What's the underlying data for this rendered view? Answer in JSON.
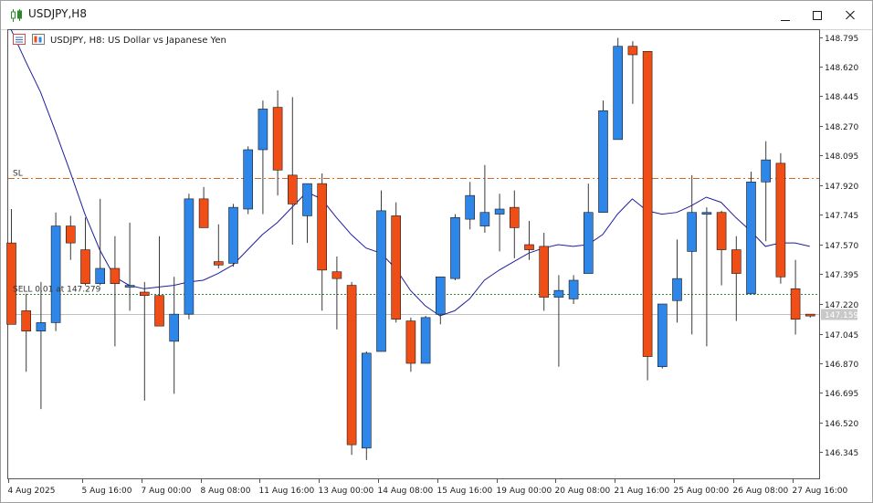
{
  "window": {
    "title": "USDJPY,H8",
    "minimize_icon": "minimize-icon",
    "maximize_icon": "maximize-icon",
    "close_icon": "close-icon"
  },
  "chart_header": {
    "text": "USDJPY, H8:  US Dollar vs Japanese Yen",
    "icons": [
      "one-click-trading-icon",
      "chart-properties-icon"
    ]
  },
  "colors": {
    "bull": "#2e86e8",
    "bear": "#f04e17",
    "wick": "#3a3a3a",
    "ma": "#1e1e9c",
    "sl_line": "#d2691e",
    "trade_line": "#2e8b2e",
    "bid_line": "#c0c0c0",
    "bid_label_bg": "#c8c8c8"
  },
  "chart_data": {
    "type": "candlestick",
    "symbol": "USDJPY",
    "timeframe": "H8",
    "title": "USDJPY, H8:  US Dollar vs Japanese Yen",
    "ylim": [
      146.2,
      148.9
    ],
    "y_ticks": [
      "148.795",
      "148.620",
      "148.445",
      "148.270",
      "148.095",
      "147.920",
      "147.745",
      "147.570",
      "147.395",
      "147.220",
      "147.045",
      "146.870",
      "146.695",
      "146.520",
      "146.345"
    ],
    "x_ticks": [
      {
        "label": "4 Aug 2025",
        "bar": 0
      },
      {
        "label": "5 Aug 16:00",
        "bar": 5
      },
      {
        "label": "7 Aug 00:00",
        "bar": 9
      },
      {
        "label": "8 Aug 08:00",
        "bar": 13
      },
      {
        "label": "11 Aug 16:00",
        "bar": 17
      },
      {
        "label": "13 Aug 00:00",
        "bar": 21
      },
      {
        "label": "14 Aug 08:00",
        "bar": 25
      },
      {
        "label": "15 Aug 16:00",
        "bar": 29
      },
      {
        "label": "19 Aug 00:00",
        "bar": 33
      },
      {
        "label": "20 Aug 08:00",
        "bar": 37
      },
      {
        "label": "21 Aug 16:00",
        "bar": 41
      },
      {
        "label": "25 Aug 00:00",
        "bar": 45
      },
      {
        "label": "26 Aug 08:00",
        "bar": 49
      },
      {
        "label": "27 Aug 16:00",
        "bar": 53
      }
    ],
    "candles": [
      {
        "o": 147.58,
        "h": 147.78,
        "l": 147.1,
        "c": 147.1
      },
      {
        "o": 147.18,
        "h": 147.28,
        "l": 146.82,
        "c": 147.06
      },
      {
        "o": 147.06,
        "h": 147.35,
        "l": 146.6,
        "c": 147.11
      },
      {
        "o": 147.11,
        "h": 147.76,
        "l": 147.06,
        "c": 147.68
      },
      {
        "o": 147.68,
        "h": 147.74,
        "l": 147.48,
        "c": 147.58
      },
      {
        "o": 147.54,
        "h": 147.73,
        "l": 147.33,
        "c": 147.34
      },
      {
        "o": 147.34,
        "h": 147.84,
        "l": 147.33,
        "c": 147.43
      },
      {
        "o": 147.43,
        "h": 147.62,
        "l": 146.97,
        "c": 147.34
      },
      {
        "o": 147.33,
        "h": 147.7,
        "l": 147.18,
        "c": 147.33
      },
      {
        "o": 147.29,
        "h": 147.35,
        "l": 146.65,
        "c": 147.27
      },
      {
        "o": 147.27,
        "h": 147.62,
        "l": 147.1,
        "c": 147.09
      },
      {
        "o": 147.0,
        "h": 147.38,
        "l": 146.69,
        "c": 147.16
      },
      {
        "o": 147.16,
        "h": 147.87,
        "l": 147.13,
        "c": 147.84
      },
      {
        "o": 147.84,
        "h": 147.91,
        "l": 147.67,
        "c": 147.67
      },
      {
        "o": 147.47,
        "h": 147.69,
        "l": 147.43,
        "c": 147.45
      },
      {
        "o": 147.46,
        "h": 147.81,
        "l": 147.44,
        "c": 147.79
      },
      {
        "o": 147.78,
        "h": 148.15,
        "l": 147.75,
        "c": 148.13
      },
      {
        "o": 148.13,
        "h": 148.42,
        "l": 147.75,
        "c": 148.37
      },
      {
        "o": 148.38,
        "h": 148.48,
        "l": 147.86,
        "c": 148.01
      },
      {
        "o": 147.98,
        "h": 148.44,
        "l": 147.57,
        "c": 147.81
      },
      {
        "o": 147.74,
        "h": 147.9,
        "l": 147.58,
        "c": 147.93
      },
      {
        "o": 147.93,
        "h": 147.99,
        "l": 147.18,
        "c": 147.42
      },
      {
        "o": 147.41,
        "h": 147.5,
        "l": 147.07,
        "c": 147.37
      },
      {
        "o": 147.33,
        "h": 147.35,
        "l": 146.33,
        "c": 146.39
      },
      {
        "o": 146.37,
        "h": 146.94,
        "l": 146.3,
        "c": 146.93
      },
      {
        "o": 146.94,
        "h": 147.89,
        "l": 146.94,
        "c": 147.77
      },
      {
        "o": 147.74,
        "h": 147.82,
        "l": 147.11,
        "c": 147.13
      },
      {
        "o": 147.12,
        "h": 147.14,
        "l": 146.82,
        "c": 146.87
      },
      {
        "o": 146.87,
        "h": 147.15,
        "l": 146.87,
        "c": 147.14
      },
      {
        "o": 147.16,
        "h": 147.35,
        "l": 147.1,
        "c": 147.38
      },
      {
        "o": 147.37,
        "h": 147.75,
        "l": 147.36,
        "c": 147.73
      },
      {
        "o": 147.72,
        "h": 147.94,
        "l": 147.66,
        "c": 147.86
      },
      {
        "o": 147.68,
        "h": 148.04,
        "l": 147.64,
        "c": 147.76
      },
      {
        "o": 147.75,
        "h": 147.87,
        "l": 147.53,
        "c": 147.78
      },
      {
        "o": 147.79,
        "h": 147.89,
        "l": 147.49,
        "c": 147.67
      },
      {
        "o": 147.57,
        "h": 147.71,
        "l": 147.48,
        "c": 147.54
      },
      {
        "o": 147.56,
        "h": 147.64,
        "l": 147.18,
        "c": 147.26
      },
      {
        "o": 147.26,
        "h": 147.39,
        "l": 146.85,
        "c": 147.3
      },
      {
        "o": 147.25,
        "h": 147.39,
        "l": 147.22,
        "c": 147.36
      },
      {
        "o": 147.4,
        "h": 147.93,
        "l": 147.4,
        "c": 147.76
      },
      {
        "o": 147.76,
        "h": 148.42,
        "l": 147.76,
        "c": 148.36
      },
      {
        "o": 148.19,
        "h": 148.79,
        "l": 148.19,
        "c": 148.74
      },
      {
        "o": 148.74,
        "h": 148.77,
        "l": 148.4,
        "c": 148.69
      },
      {
        "o": 148.71,
        "h": 148.71,
        "l": 146.77,
        "c": 146.91
      },
      {
        "o": 146.85,
        "h": 147.21,
        "l": 146.84,
        "c": 147.22
      },
      {
        "o": 147.24,
        "h": 147.6,
        "l": 147.11,
        "c": 147.37
      },
      {
        "o": 147.53,
        "h": 147.98,
        "l": 147.04,
        "c": 147.76
      },
      {
        "o": 147.76,
        "h": 147.79,
        "l": 146.97,
        "c": 147.76
      },
      {
        "o": 147.76,
        "h": 147.77,
        "l": 147.33,
        "c": 147.54
      },
      {
        "o": 147.54,
        "h": 147.62,
        "l": 147.12,
        "c": 147.4
      },
      {
        "o": 147.28,
        "h": 148.0,
        "l": 147.28,
        "c": 147.94
      },
      {
        "o": 147.94,
        "h": 148.18,
        "l": 147.59,
        "c": 148.07
      },
      {
        "o": 148.05,
        "h": 148.11,
        "l": 147.34,
        "c": 147.38
      },
      {
        "o": 147.31,
        "h": 147.48,
        "l": 147.04,
        "c": 147.13
      },
      {
        "o": 147.16,
        "h": 147.16,
        "l": 147.14,
        "c": 147.159
      }
    ],
    "moving_average": [
      148.84,
      148.65,
      148.47,
      148.24,
      148.0,
      147.75,
      147.54,
      147.38,
      147.33,
      147.31,
      147.32,
      147.33,
      147.35,
      147.36,
      147.4,
      147.45,
      147.54,
      147.63,
      147.7,
      147.79,
      147.88,
      147.84,
      147.73,
      147.63,
      147.55,
      147.52,
      147.43,
      147.3,
      147.21,
      147.15,
      147.18,
      147.25,
      147.36,
      147.42,
      147.47,
      147.52,
      147.55,
      147.57,
      147.56,
      147.57,
      147.63,
      147.75,
      147.84,
      147.77,
      147.75,
      147.76,
      147.8,
      147.85,
      147.82,
      147.73,
      147.65,
      147.56,
      147.58,
      147.58,
      147.56
    ],
    "levels": [
      {
        "name": "SL",
        "label": "SL",
        "price": 147.965,
        "style": "dash-dot"
      },
      {
        "name": "trade",
        "label": "SELL 0.01 at 147.279",
        "price": 147.279,
        "style": "dotted"
      },
      {
        "name": "bid",
        "label": "147.159",
        "price": 147.159,
        "style": "solid"
      }
    ]
  }
}
